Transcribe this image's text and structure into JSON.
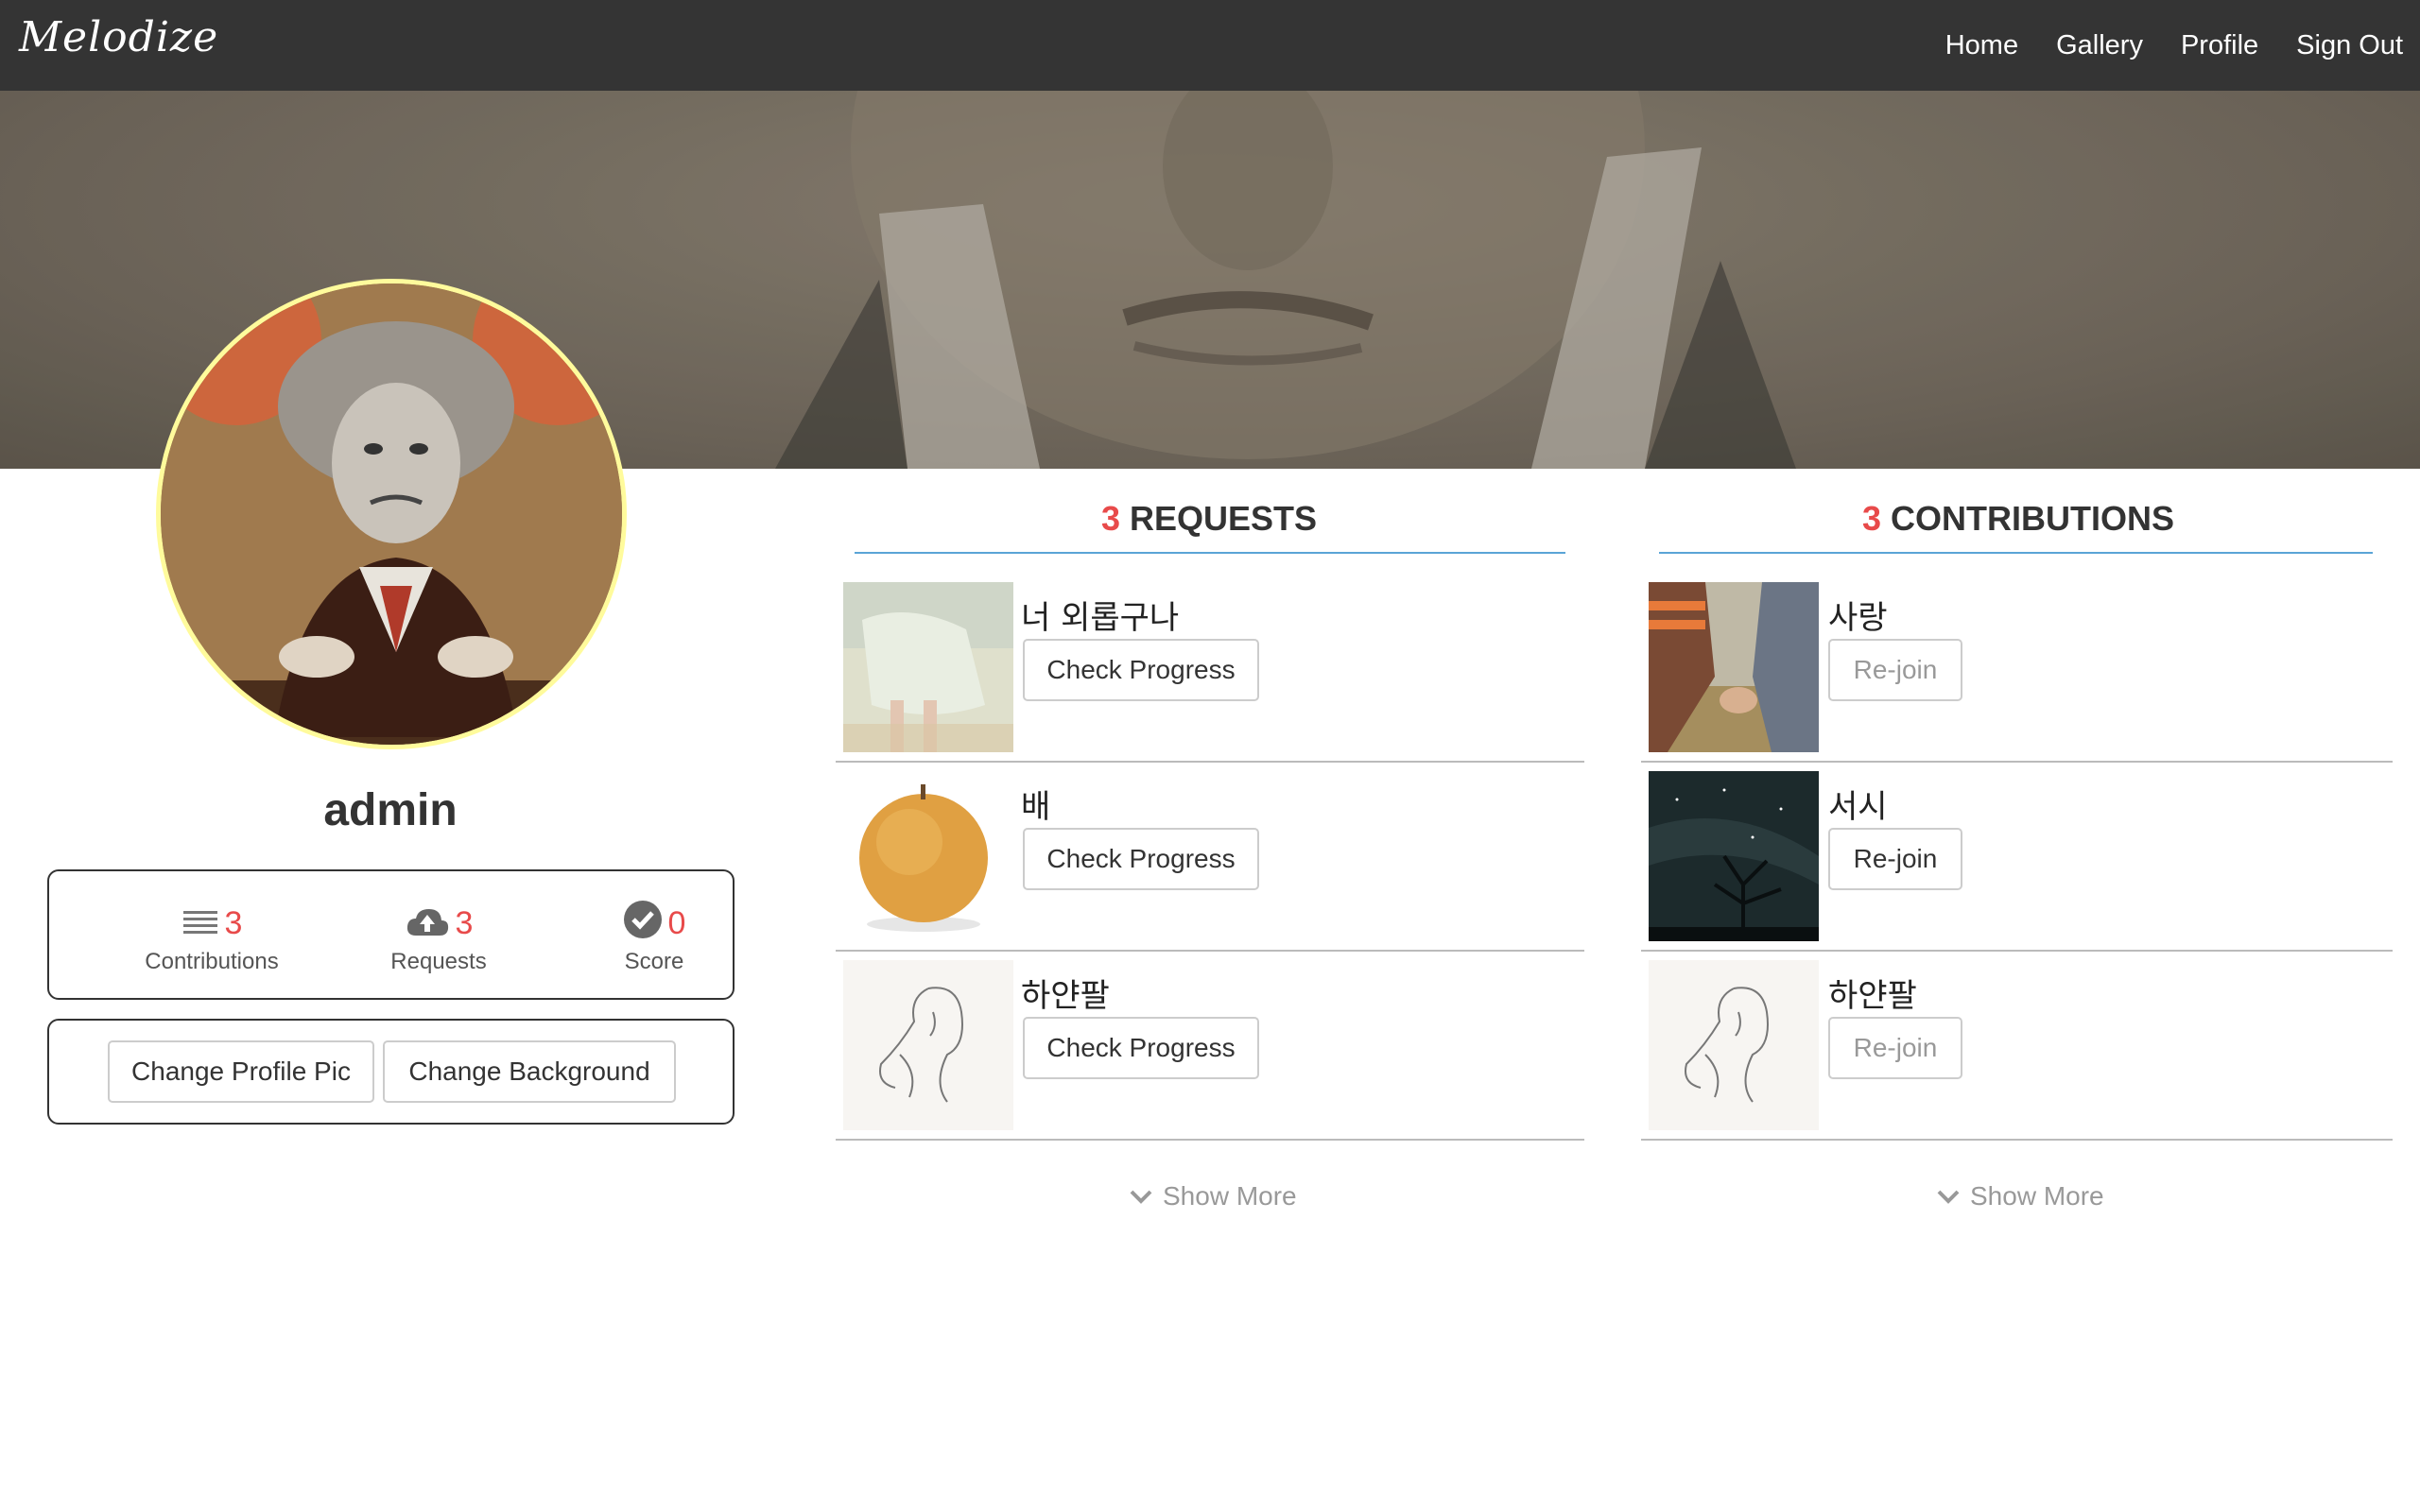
{
  "app": {
    "brand": "Melodize"
  },
  "nav": {
    "items": [
      {
        "label": "Home"
      },
      {
        "label": "Gallery"
      },
      {
        "label": "Profile"
      },
      {
        "label": "Sign Out"
      }
    ]
  },
  "profile": {
    "username": "admin",
    "stats": {
      "contributions": {
        "value": "3",
        "label": "Contributions",
        "icon": "list-icon"
      },
      "requests": {
        "value": "3",
        "label": "Requests",
        "icon": "cloud-upload-icon"
      },
      "score": {
        "value": "0",
        "label": "Score",
        "icon": "check-circle-icon"
      }
    },
    "buttons": {
      "change_pic": "Change Profile Pic",
      "change_background": "Change Background"
    }
  },
  "requests": {
    "count": "3",
    "title": "REQUESTS",
    "items": [
      {
        "title": "너 외롭구나",
        "action": "Check Progress"
      },
      {
        "title": "배",
        "action": "Check Progress"
      },
      {
        "title": "하얀팔",
        "action": "Check Progress"
      }
    ],
    "show_more": "Show More"
  },
  "contributions": {
    "count": "3",
    "title": "CONTRIBUTIONS",
    "items": [
      {
        "title": "사랑",
        "action": "Re-join",
        "state": "disabled"
      },
      {
        "title": "서시",
        "action": "Re-join",
        "state": "enabled"
      },
      {
        "title": "하얀팔",
        "action": "Re-join",
        "state": "disabled"
      }
    ],
    "show_more": "Show More"
  },
  "colors": {
    "navbar": "#343434",
    "accent_red": "#e84a4a",
    "underline_blue": "#5aa4d6",
    "avatar_border": "#fffb9c"
  }
}
